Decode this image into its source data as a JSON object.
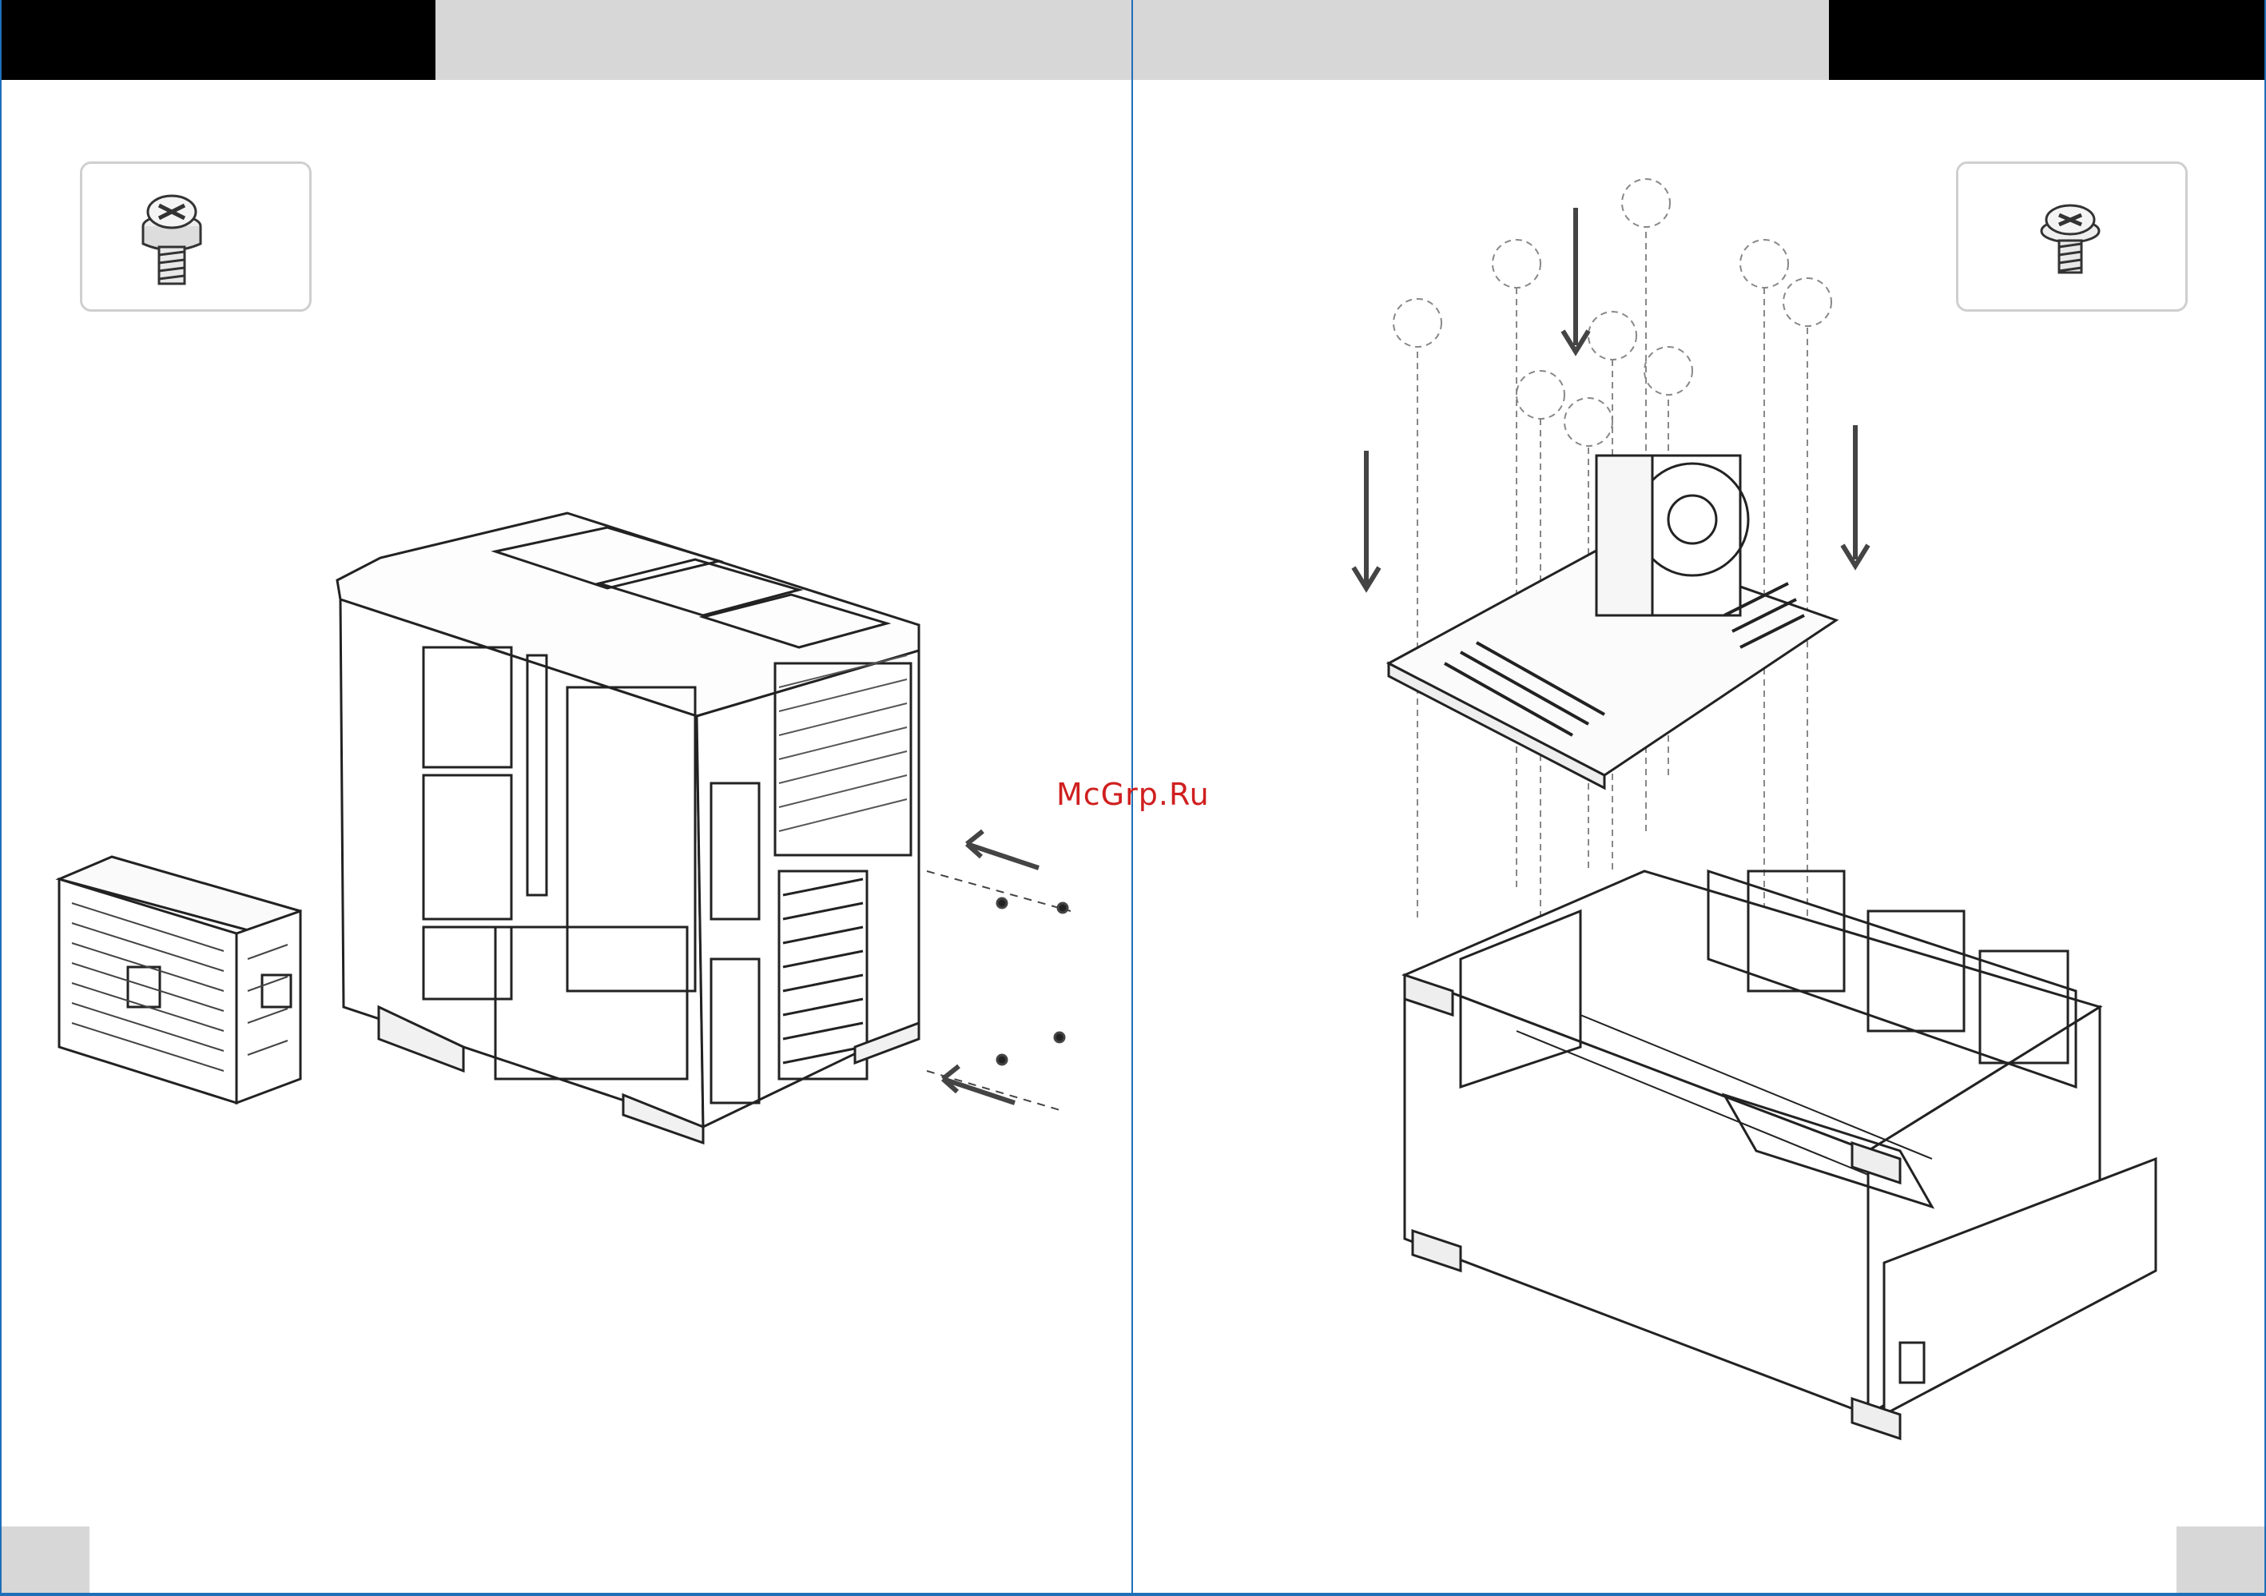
{
  "watermark": {
    "text": "McGrp.Ru",
    "color": "#d01f1f"
  },
  "colors": {
    "header_black": "#000000",
    "header_grey": "#d7d7d8",
    "border_blue": "#1f6fb8",
    "line": "#222222"
  },
  "left_page": {
    "screw_icon": "phillips-hex-screw-icon",
    "drawing": "psu-installation-illustration"
  },
  "right_page": {
    "screw_icon": "phillips-motherboard-screw-icon",
    "drawing": "motherboard-installation-illustration"
  }
}
